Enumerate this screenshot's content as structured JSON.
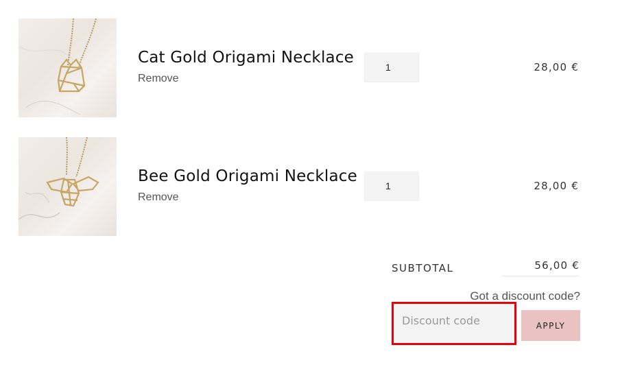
{
  "cart": {
    "items": [
      {
        "title": "Cat Gold Origami Necklace",
        "remove_label": "Remove",
        "quantity": "1",
        "price": "28,00 €",
        "image_icon": "cat-necklace-image"
      },
      {
        "title": "Bee Gold Origami Necklace",
        "remove_label": "Remove",
        "quantity": "1",
        "price": "28,00 €",
        "image_icon": "bee-necklace-image"
      }
    ]
  },
  "summary": {
    "subtotal_label": "SUBTOTAL",
    "subtotal_value": "56,00 €"
  },
  "discount": {
    "prompt": "Got a discount code?",
    "placeholder": "Discount code",
    "value": "",
    "apply_label": "APPLY",
    "highlight_color": "#e8000b",
    "apply_button_color": "#ebc2c2"
  }
}
